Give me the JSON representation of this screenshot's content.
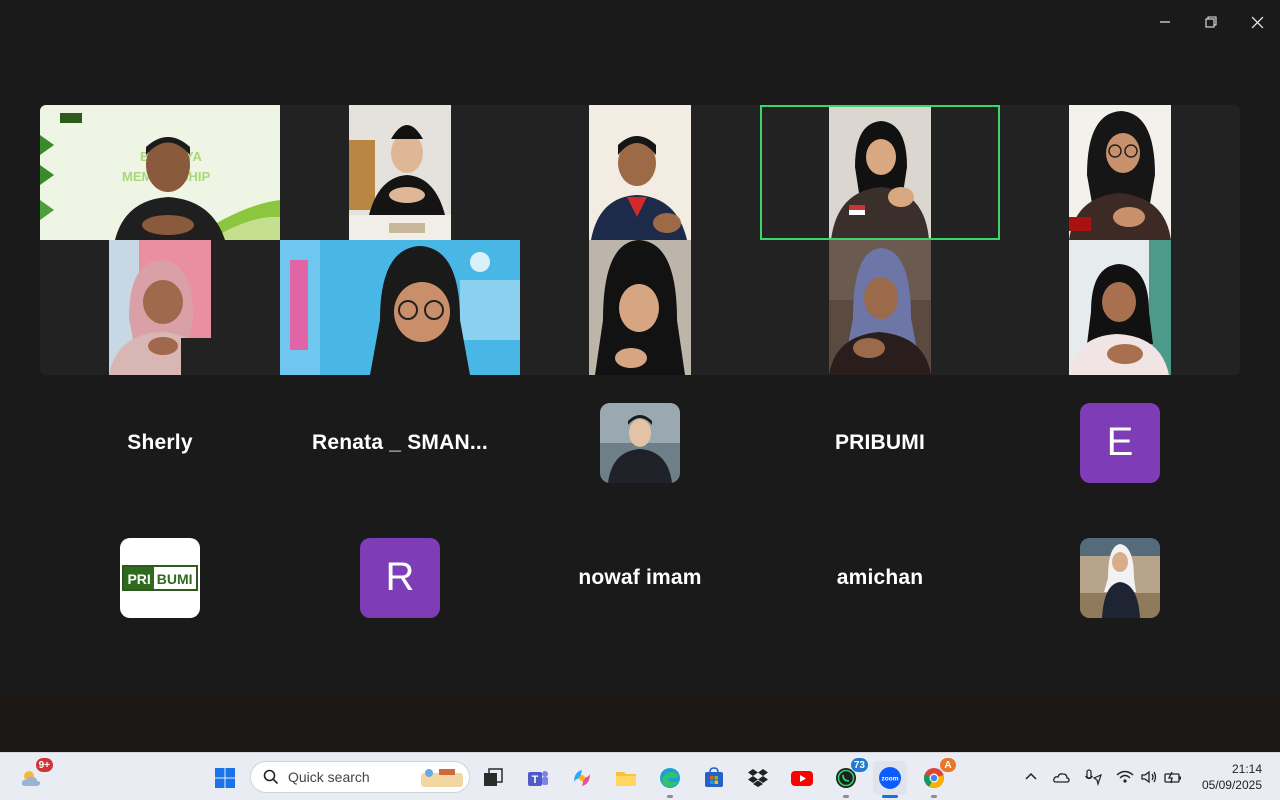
{
  "window": {
    "controls": {
      "minimize_icon": "minimize-icon",
      "restore_icon": "restore-icon",
      "close_icon": "close-icon"
    }
  },
  "gallery": {
    "active_speaker_color": "#3ad66a",
    "name_tiles_row1": [
      {
        "type": "name",
        "label": "Sherly"
      },
      {
        "type": "name",
        "label": "Renata _ SMAN..."
      },
      {
        "type": "photo",
        "label": ""
      },
      {
        "type": "name",
        "label": "PRIBUMI"
      },
      {
        "type": "letter",
        "label": "E"
      }
    ],
    "name_tiles_row2": [
      {
        "type": "logo",
        "logo_left": "PRI",
        "logo_right": "BUMI"
      },
      {
        "type": "letter",
        "label": "R"
      },
      {
        "type": "name",
        "label": "nowaf imam"
      },
      {
        "type": "name",
        "label": "amichan"
      },
      {
        "type": "photo",
        "label": ""
      }
    ]
  },
  "taskbar": {
    "weather_badge": "9+",
    "search_placeholder": "Quick search",
    "whatsapp_badge": "73",
    "zoom_label": "zoom",
    "chrome_badge": "A",
    "clock_time": "21:14",
    "clock_date": "05/09/2025"
  }
}
